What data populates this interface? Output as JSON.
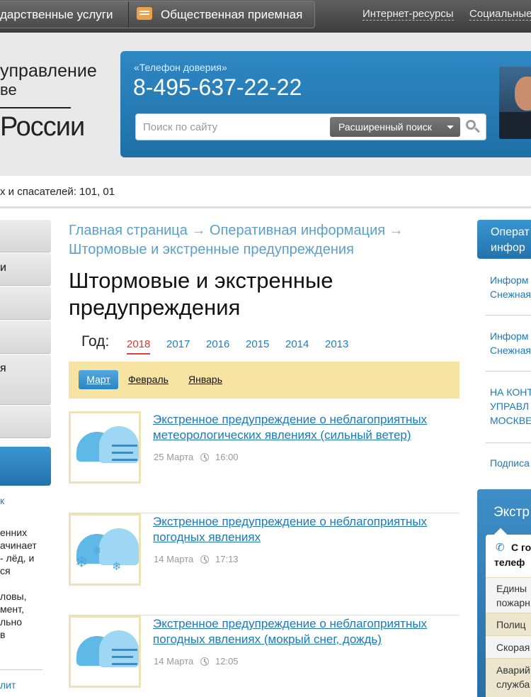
{
  "topbar": {
    "gos_services": "дарственные услуги",
    "public_reception": "Общественная приемная",
    "internet_resources": "Интернет-ресурсы",
    "social": "Социальные"
  },
  "header": {
    "logo_line1": "управление",
    "logo_line2": "ве",
    "logo_line3": "России",
    "hotline_label": "«Телефон доверия»",
    "hotline_phone": "8-495-637-22-22",
    "search_placeholder": "Поиск по сайту",
    "advanced_search": "Расширенный поиск"
  },
  "ticker": {
    "text": "х и спасателей: 101, 01"
  },
  "left_nav": {
    "items": [
      "",
      "и",
      "",
      "",
      "я",
      ""
    ],
    "link": "к",
    "text_lines": [
      "енних",
      "ачинает",
      "- лёд, и",
      "ся",
      "",
      "ловы,",
      "мент,",
      "льно",
      "в"
    ],
    "link2": "лит"
  },
  "breadcrumb": {
    "home": "Главная страница",
    "arrow": "→",
    "operative": "Оперативная информация",
    "current": "Штормовые и экстренные предупреждения"
  },
  "page": {
    "title": "Штормовые и экстренные предупреждения",
    "year_label": "Год:",
    "years": [
      "2018",
      "2017",
      "2016",
      "2015",
      "2014",
      "2013"
    ],
    "active_year": "2018",
    "months": [
      "Март",
      "Февраль",
      "Январь"
    ],
    "active_month": "Март"
  },
  "news": [
    {
      "title": "Экстренное предупреждение о неблагоприятных метеорологических явлениях (сильный ветер)",
      "date": "25 Марта",
      "time": "16:00",
      "icon": "wind-cloud-icon"
    },
    {
      "title": "Экстренное предупреждение о неблагоприятных погодных явлениях",
      "date": "14 Марта",
      "time": "17:13",
      "icon": "snow-cloud-icon"
    },
    {
      "title": "Экстренное предупреждение о неблагоприятных погодных явлениях (мокрый снег, дождь)",
      "date": "14 Марта",
      "time": "12:05",
      "icon": "wind-cloud-icon"
    }
  ],
  "right_panel": {
    "head_line1": "Операт",
    "head_line2": "инфор",
    "links": [
      [
        "Информ",
        "Снежная"
      ],
      [
        "Информ",
        "Снежная"
      ],
      [
        "НА КОНТ",
        "УПРАВЛ",
        "МОСКВЕ"
      ]
    ],
    "subscribe": "Подписа"
  },
  "emergency": {
    "title": "Экстр",
    "head_line1": "С го",
    "head_line2": "телеф",
    "rows": [
      [
        "Едины",
        "пожарн"
      ],
      [
        "Полиц"
      ],
      [
        "Скорая"
      ],
      [
        "Аварий",
        "служба"
      ]
    ]
  },
  "colors": {
    "link": "#1d79b8",
    "accent_blue": "#2a7fbf",
    "active_year": "#e04040",
    "month_bar": "#f7e3a2",
    "topbar": "#4a4a4a"
  }
}
